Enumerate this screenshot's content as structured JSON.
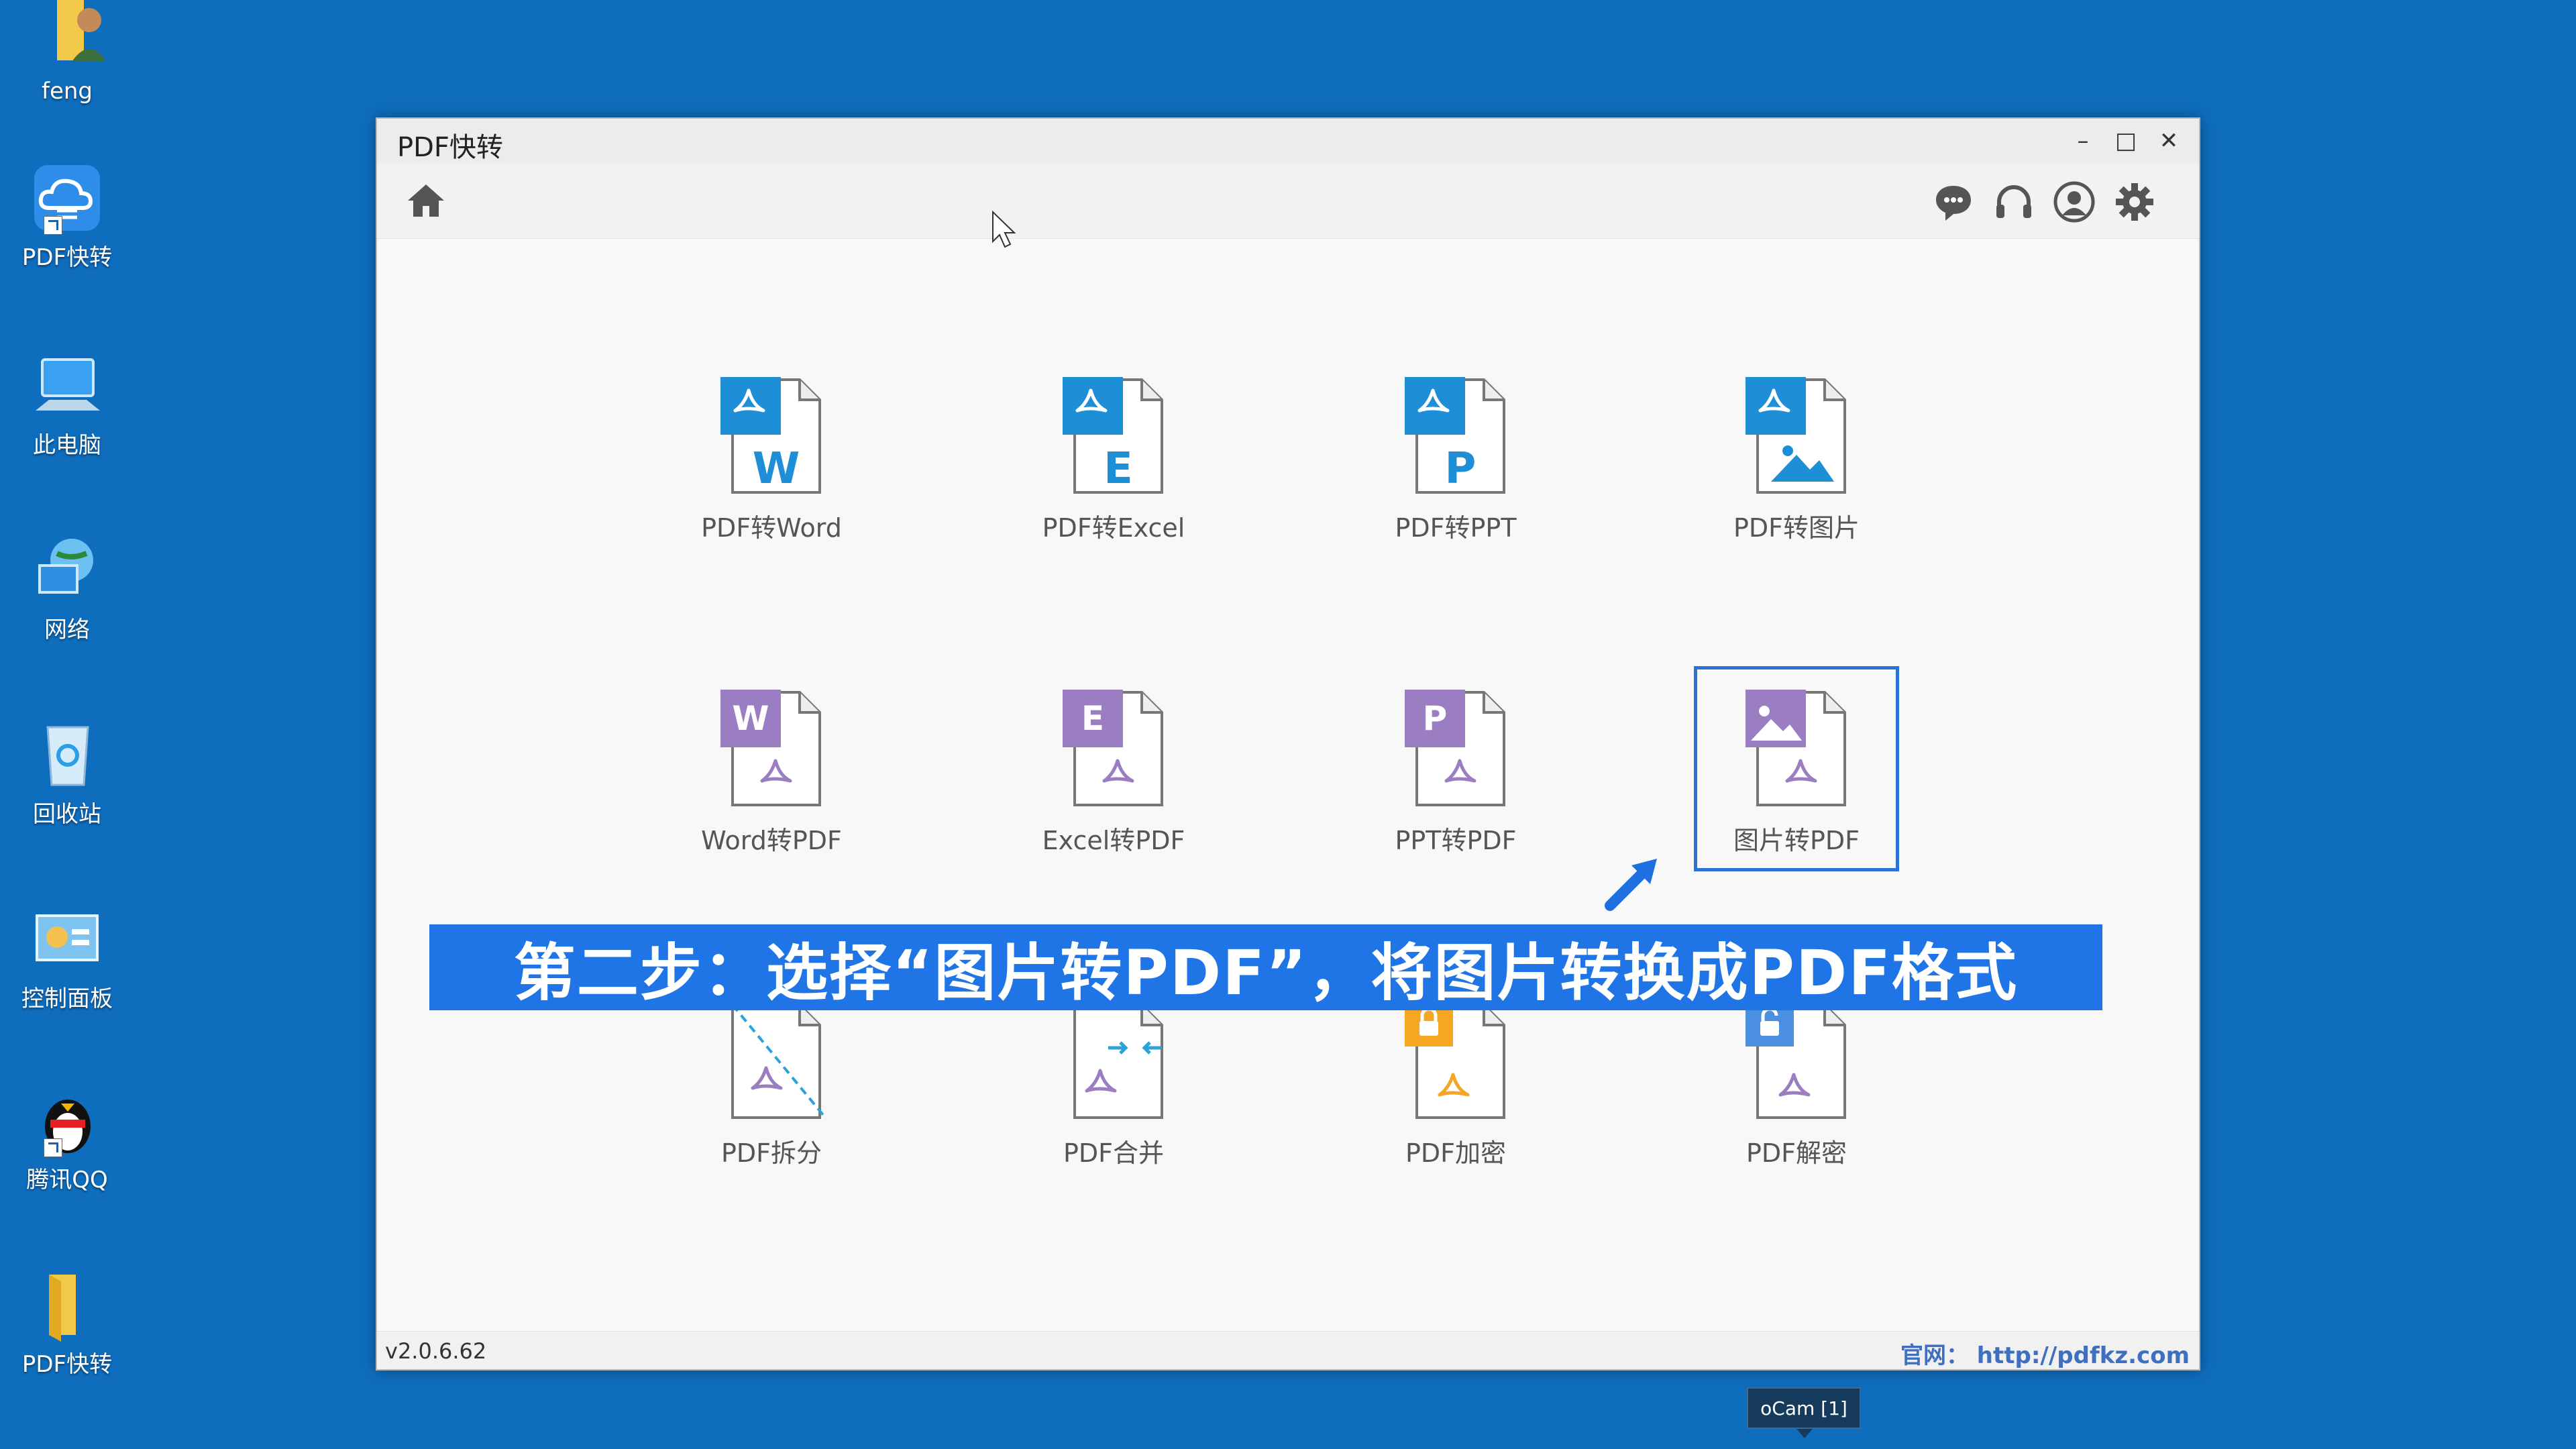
{
  "desktop": {
    "icons": [
      {
        "label": "feng",
        "icon": "user-folder-icon"
      },
      {
        "label": "PDF快转",
        "icon": "cloud-app-icon"
      },
      {
        "label": "此电脑",
        "icon": "computer-icon"
      },
      {
        "label": "网络",
        "icon": "network-icon"
      },
      {
        "label": "回收站",
        "icon": "recycle-bin-icon"
      },
      {
        "label": "控制面板",
        "icon": "control-panel-icon"
      },
      {
        "label": "腾讯QQ",
        "icon": "qq-penguin-icon"
      },
      {
        "label": "PDF快转",
        "icon": "folder-icon"
      }
    ]
  },
  "window": {
    "title": "PDF快转",
    "controls": {
      "minimize": "–",
      "maximize": "□",
      "close": "✕"
    },
    "toolbar": {
      "home_icon": "home-icon",
      "right_icons": [
        "chat-icon",
        "headset-icon",
        "user-icon",
        "gear-icon"
      ]
    },
    "tools": [
      {
        "label": "PDF转Word",
        "letter": "W",
        "kind": "from-pdf"
      },
      {
        "label": "PDF转Excel",
        "letter": "E",
        "kind": "from-pdf"
      },
      {
        "label": "PDF转PPT",
        "letter": "P",
        "kind": "from-pdf"
      },
      {
        "label": "PDF转图片",
        "letter": "",
        "kind": "from-pdf-image"
      },
      {
        "label": "Word转PDF",
        "letter": "W",
        "kind": "to-pdf"
      },
      {
        "label": "Excel转PDF",
        "letter": "E",
        "kind": "to-pdf"
      },
      {
        "label": "PPT转PDF",
        "letter": "P",
        "kind": "to-pdf"
      },
      {
        "label": "图片转PDF",
        "letter": "",
        "kind": "to-pdf-image",
        "selected": true
      },
      {
        "label": "PDF拆分",
        "letter": "",
        "kind": "split"
      },
      {
        "label": "PDF合并",
        "letter": "",
        "kind": "merge"
      },
      {
        "label": "PDF加密",
        "letter": "",
        "kind": "encrypt"
      },
      {
        "label": "PDF解密",
        "letter": "",
        "kind": "decrypt"
      }
    ],
    "banner": "第二步：选择“图片转PDF”，将图片转换成PDF格式",
    "footer": {
      "version": "v2.0.6.62",
      "site": "官网：  http://pdfkz.com"
    }
  },
  "taskbar_tip": "oCam [1]",
  "colors": {
    "desktop": "#0f6dbd",
    "accent_blue": "#1e8fd6",
    "accent_purple": "#9b7ec2",
    "banner": "#1f74e6"
  }
}
